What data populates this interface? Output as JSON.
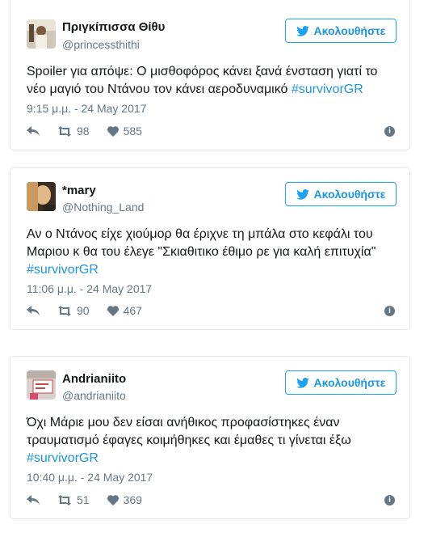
{
  "follow_label": "Ακολουθήστε",
  "tweets": [
    {
      "name": "Πριγκίπισσα Θίθυ",
      "handle": "@princessthithi",
      "text_before": "Spoiler για απόψε: Ο μισθοφόρος κάνει ξανά ένσταση γιατί το νέο μαγιό του Ντάνου τον κάνει αεροδυναμικό ",
      "hashtag": "#survivorGR",
      "time": "9:15 μ.μ. - 24 May 2017",
      "retweets": "98",
      "likes": "585"
    },
    {
      "name": "*mary",
      "handle": "@Nothing_Land",
      "text_before": "Αν ο Ντάνος είχε χιούμορ θα έριχνε τη μπάλα στο κεφάλι του Μαριου κ θα του έλεγε \"Σκιαθιτικο έθιμο ρε για καλή επιτυχία\" ",
      "hashtag": "#survivorGR",
      "time": "11:06 μ.μ. - 24 May 2017",
      "retweets": "90",
      "likes": "467"
    },
    {
      "name": "Andrianiito",
      "handle": "@andrianiito",
      "text_before": "Όχι Μάριε μου δεν είσαι ανήθικος προφασίστηκες έναν τραυματισμό έφαγες κοιμήθηκες και έμαθες τι γίνεται έξω ",
      "hashtag": "#survivorGR",
      "time": "10:40 μ.μ. - 24 May 2017",
      "retweets": "51",
      "likes": "369"
    }
  ],
  "icons": {
    "bird": "twitter-bird-icon",
    "reply": "reply-icon",
    "retweet": "retweet-icon",
    "like": "heart-icon",
    "info": "info-icon"
  },
  "colors": {
    "link": "#1b95e0",
    "muted": "#657786",
    "border": "#e1e8ed"
  }
}
